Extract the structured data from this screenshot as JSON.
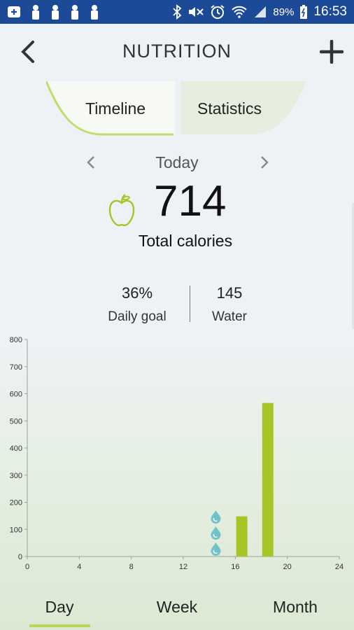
{
  "status_bar": {
    "battery": "89%",
    "time": "16:53"
  },
  "header": {
    "title": "NUTRITION"
  },
  "tabs": [
    {
      "label": "Timeline",
      "active": true
    },
    {
      "label": "Statistics",
      "active": false
    }
  ],
  "date_nav": {
    "label": "Today"
  },
  "summary": {
    "calories": "714",
    "calories_caption": "Total calories"
  },
  "stats": {
    "goal_value": "36%",
    "goal_label": "Daily goal",
    "water_value": "145",
    "water_label": "Water"
  },
  "colors": {
    "accent": "#b9d65a",
    "bar": "#a8c528",
    "status_bar": "#1d4a96",
    "water": "#6fc3c9"
  },
  "chart_data": {
    "type": "bar",
    "xlim": [
      0,
      24
    ],
    "ylim": [
      0,
      800
    ],
    "x_ticks": [
      0,
      4,
      8,
      12,
      16,
      20,
      24
    ],
    "y_ticks": [
      0,
      100,
      200,
      300,
      400,
      500,
      600,
      700,
      800
    ],
    "bars": [
      {
        "x": 16.5,
        "value": 148
      },
      {
        "x": 18.5,
        "value": 566
      }
    ],
    "water_drops": {
      "x": 14.5,
      "count": 3
    }
  },
  "period_tabs": {
    "day": "Day",
    "week": "Week",
    "month": "Month",
    "selected": "Day"
  }
}
